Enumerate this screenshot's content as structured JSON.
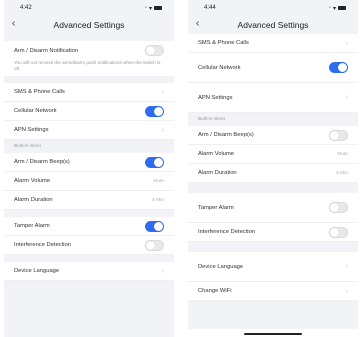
{
  "left": {
    "time": "4:42",
    "title": "Advanced Settings",
    "arm_notification": {
      "label": "Arm / Disarm Notification",
      "note": "You will not receive the arm/disarm push notifications when the switch is off."
    },
    "sms": "SMS & Phone Calls",
    "cellular": "Cellular Network",
    "apn": "APN Settings",
    "section": "Built-in Siren",
    "beep": "Arm / Disarm Beep(s)",
    "volume": {
      "label": "Alarm Volume",
      "value": "Mute"
    },
    "duration": {
      "label": "Alarm Duration",
      "value": "5 Min"
    },
    "tamper": "Tamper Alarm",
    "interference": "Interference Detection",
    "language": "Device Language"
  },
  "right": {
    "time": "4:44",
    "title": "Advanced Settings",
    "sms": "SMS & Phone Calls",
    "cellular": "Cellular Network",
    "apn": "APN Settings",
    "section": "Built-in Siren",
    "beep": "Arm / Disarm Beep(s)",
    "volume": {
      "label": "Alarm Volume",
      "value": "Mute"
    },
    "duration": {
      "label": "Alarm Duration",
      "value": "5 Min"
    },
    "tamper": "Tamper Alarm",
    "interference": "Interference Detection",
    "language": "Device Language",
    "wifi": "Change WiFi"
  },
  "icons": {
    "back": "back-chevron-icon",
    "chevron": "chevron-right-icon",
    "signal": "signal-icon",
    "battery": "battery-icon"
  },
  "colors": {
    "toggle_on": "#2f6df0",
    "background": "#f2f3f6"
  }
}
